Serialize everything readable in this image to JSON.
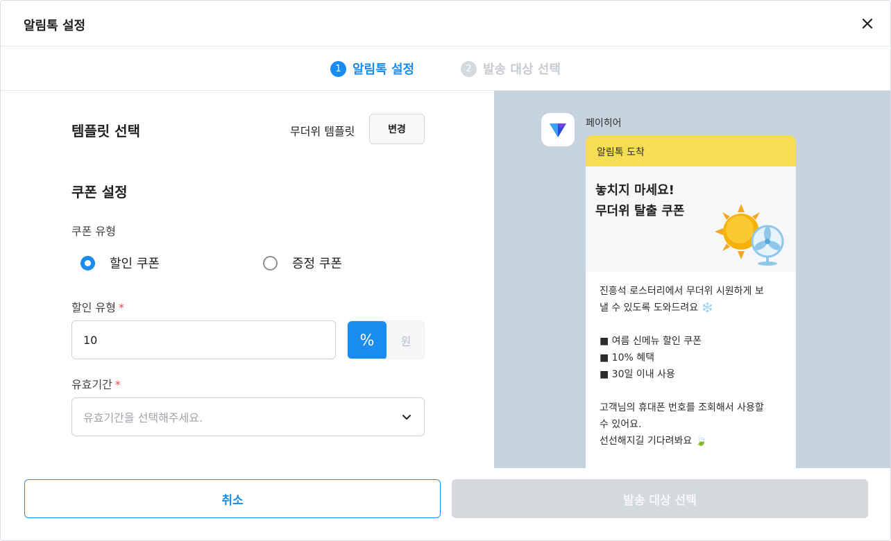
{
  "header": {
    "title": "알림톡 설정",
    "close_icon": "close-icon"
  },
  "stepper": {
    "steps": [
      {
        "num": "1",
        "label": "알림톡 설정",
        "active": true
      },
      {
        "num": "2",
        "label": "발송 대상 선택",
        "active": false
      }
    ]
  },
  "form": {
    "template": {
      "title": "템플릿 선택",
      "selected": "무더위 템플릿",
      "change_label": "변경"
    },
    "coupon": {
      "title": "쿠폰 설정",
      "type_label": "쿠폰 유형",
      "options": [
        "할인 쿠폰",
        "증정 쿠폰"
      ],
      "selected": "할인 쿠폰",
      "discount_label": "할인 유형",
      "required_mark": "*",
      "discount_value": "10",
      "unit_percent": "%",
      "unit_won": "원",
      "unit_selected": "%",
      "validity_label": "유효기간",
      "validity_placeholder": "유효기간을 선택해주세요."
    }
  },
  "preview": {
    "sender": "페이히어",
    "header": "알림톡 도착",
    "hero_title": "놓치지 마세요!\n무더위 탈출 쿠폰",
    "body": "진흥석 로스터리에서 무더위 시원하게 보\n낼 수 있도록 도와드려요 ❄️\n\n■ 여름 신메뉴 할인 쿠폰\n■ 10% 혜택\n■ 30일 이내 사용\n\n고객님의 휴대폰 번호를 조회해서 사용할\n수 있어요.\n선선해지길 기다려봐요 🍃"
  },
  "footer": {
    "cancel_label": "취소",
    "next_label": "발송 대상 선택"
  },
  "colors": {
    "accent": "#1a8cf0",
    "preview_bg": "#c6d3de",
    "kakao_yellow": "#f5dd54",
    "disabled": "#d5d8dc",
    "required": "#e5484d"
  }
}
